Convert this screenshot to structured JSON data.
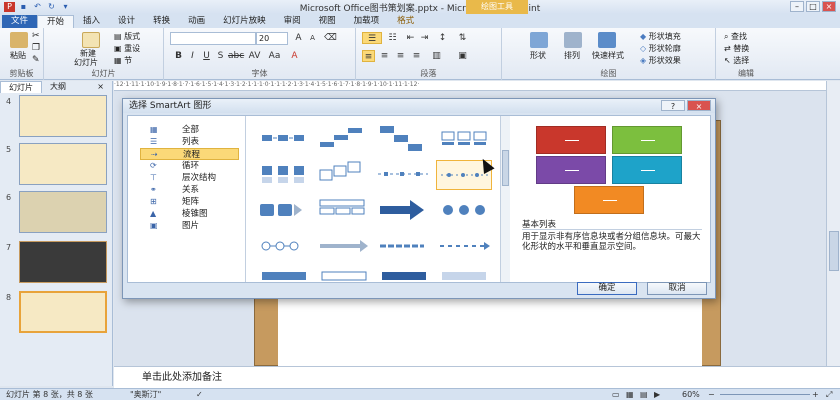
{
  "window": {
    "title": "Microsoft Office图书策划案.pptx - Microsoft PowerPoint",
    "context_tools": "绘图工具"
  },
  "tabs": [
    "文件",
    "开始",
    "插入",
    "设计",
    "转换",
    "动画",
    "幻灯片放映",
    "审阅",
    "视图",
    "加载项",
    "格式"
  ],
  "ribbon": {
    "clipboard": {
      "paste": "粘贴",
      "label": "剪贴板"
    },
    "slides": {
      "new_slide": "新建",
      "new_slide2": "幻灯片",
      "layout": "版式",
      "reset": "重设",
      "section": "节",
      "label": "幻灯片"
    },
    "font": {
      "size": "20",
      "label": "字体"
    },
    "paragraph": {
      "label": "段落"
    },
    "drawing": {
      "shape": "形状",
      "arrange": "排列",
      "quick_styles": "快速样式",
      "fill": "形状填充",
      "outline": "形状轮廓",
      "effects": "形状效果",
      "label": "绘图"
    },
    "editing": {
      "find": "查找",
      "replace": "替换",
      "select": "选择",
      "label": "编辑"
    }
  },
  "left_pane": {
    "tabs": [
      "幻灯片",
      "大纲"
    ],
    "slide_numbers": [
      "4",
      "5",
      "6",
      "7",
      "8"
    ]
  },
  "ruler_text": "·12·1·11·1·10·1·9·1·8·1·7·1·6·1·5·1·4·1·3·1·2·1·1·1·0·1·1·1·2·1·3·1·4·1·5·1·6·1·7·1·8·1·9·1·10·1·11·1·12·",
  "dialog": {
    "title": "选择 SmartArt 图形",
    "categories": [
      {
        "label": "全部",
        "icon": "all-icon"
      },
      {
        "label": "列表",
        "icon": "list-icon"
      },
      {
        "label": "流程",
        "icon": "process-icon"
      },
      {
        "label": "循环",
        "icon": "cycle-icon"
      },
      {
        "label": "层次结构",
        "icon": "hierarchy-icon"
      },
      {
        "label": "关系",
        "icon": "relationship-icon"
      },
      {
        "label": "矩阵",
        "icon": "matrix-icon"
      },
      {
        "label": "棱锥图",
        "icon": "pyramid-icon"
      },
      {
        "label": "图片",
        "icon": "picture-icon"
      }
    ],
    "selected_category": "流程",
    "preview_title": "基本列表",
    "preview_description": "用于显示非有序信息块或者分组信息块。可最大化形状的水平和垂直显示空间。",
    "preview_colors": [
      "#c9372c",
      "#7cbf3e",
      "#7b4aa8",
      "#1ea3c9",
      "#f28a23"
    ],
    "ok_label": "确定",
    "cancel_label": "取消"
  },
  "notes_placeholder": "单击此处添加备注",
  "status": {
    "slide_info": "幻灯片 第 8 张，共 8 张",
    "theme": "\"奥斯汀\"",
    "zoom": "60%"
  }
}
